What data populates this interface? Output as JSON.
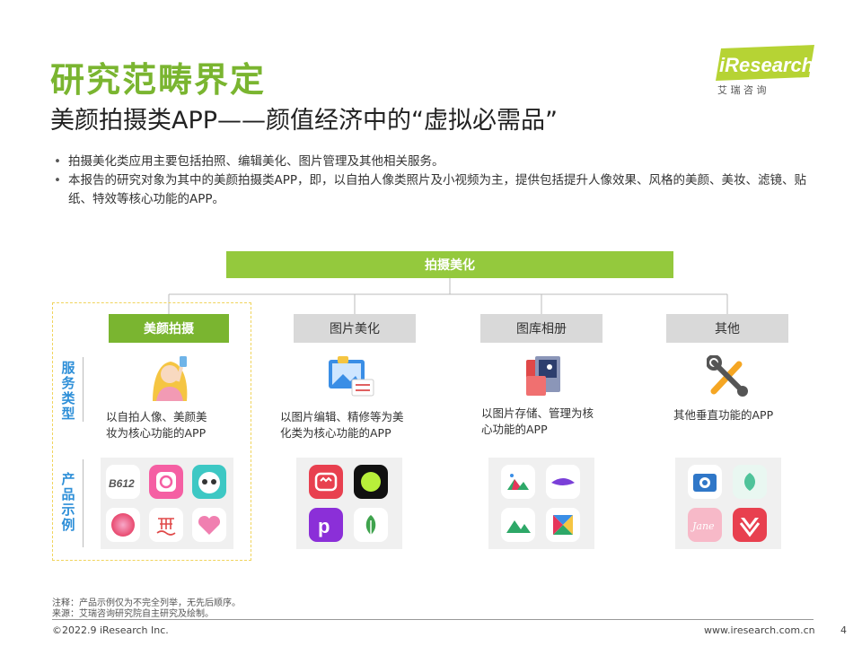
{
  "title": "研究范畴界定",
  "subtitle": "美颜拍摄类APP——颜值经济中的“虚拟必需品”",
  "logo": {
    "brand": "iResearch",
    "cn": "艾 瑞 咨 询"
  },
  "bullets": [
    "拍摄美化类应用主要包括拍照、编辑美化、图片管理及其他相关服务。",
    "本报告的研究对象为其中的美颜拍摄类APP，即，以自拍人像类照片及小视频为主，提供包括提升人像效果、风格的美颜、美妆、滤镜、贴纸、特效等核心功能的APP。"
  ],
  "diagram": {
    "root": "拍摄美化",
    "side_labels": {
      "service": "服务类型",
      "product": "产品示例"
    },
    "categories": [
      {
        "label": "美颜拍摄",
        "desc_line1": "以自拍人像、美颜美",
        "desc_line2": "妆为核心功能的APP",
        "icon": "selfie-girl-icon"
      },
      {
        "label": "图片美化",
        "desc_line1": "以图片编辑、精修等为美",
        "desc_line2": "化类为核心功能的APP",
        "icon": "photo-edit-icon"
      },
      {
        "label": "图库相册",
        "desc_line1": "以图片存储、管理为核",
        "desc_line2": "心功能的APP",
        "icon": "album-icon"
      },
      {
        "label": "其他",
        "desc_line1": "其他垂直功能的APP",
        "desc_line2": "",
        "icon": "tools-icon"
      }
    ],
    "app_logos": {
      "b612_text": "B612",
      "jane_text": "Jane"
    }
  },
  "footnotes": {
    "note": "注释：产品示例仅为不完全列举，无先后顺序。",
    "source": "来源：艾瑞咨询研究院自主研究及绘制。"
  },
  "footer": {
    "copyright": "©2022.9 iResearch Inc.",
    "website": "www.iresearch.com.cn",
    "page": "4"
  },
  "colors": {
    "brand_green": "#7ab530",
    "light_green": "#94c93d",
    "side_blue": "#2e8fd8",
    "dash_yellow": "#f0d45c"
  }
}
